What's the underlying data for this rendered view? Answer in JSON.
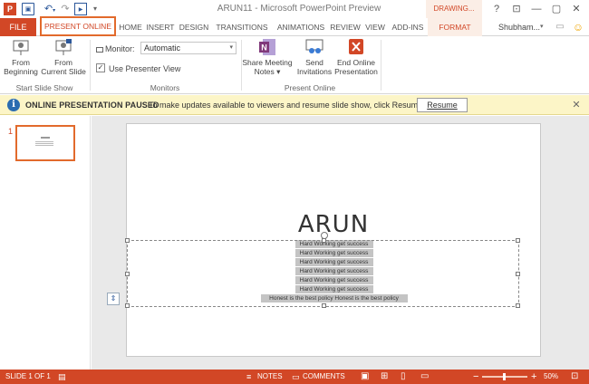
{
  "title_bar": {
    "app_logo": "P",
    "window_title": "ARUN11 - Microsoft PowerPoint Preview",
    "context_tab_group": "DRAWING...",
    "help_label": "?",
    "ribbon_display_label": "⊡",
    "minimize_label": "—",
    "restore_label": "▢",
    "close_label": "✕"
  },
  "tabs": {
    "file": "FILE",
    "items": [
      "PRESENT ONLINE",
      "HOME",
      "INSERT",
      "DESIGN",
      "TRANSITIONS",
      "ANIMATIONS",
      "REVIEW",
      "VIEW",
      "ADD-INS",
      "FORMAT"
    ],
    "active": "PRESENT ONLINE",
    "user_name": "Shubham..."
  },
  "ribbon": {
    "start_slide_show": {
      "from_beginning": [
        "From",
        "Beginning"
      ],
      "from_current": [
        "From",
        "Current Slide"
      ],
      "group_label": "Start Slide Show"
    },
    "monitors": {
      "monitor_label": "Monitor:",
      "monitor_value": "Automatic",
      "presenter_view_label": "Use Presenter View",
      "presenter_view_checked": true,
      "group_label": "Monitors"
    },
    "present_online": {
      "share_notes": [
        "Share Meeting",
        "Notes ▾"
      ],
      "send_invitations": [
        "Send",
        "Invitations"
      ],
      "end_online": [
        "End Online",
        "Presentation"
      ],
      "group_label": "Present Online"
    }
  },
  "message_bar": {
    "title": "ONLINE PRESENTATION PAUSED",
    "text": "To make updates available to viewers and resume slide show, click Resume.",
    "resume_label": "Resume",
    "close_label": "✕"
  },
  "thumbnails": [
    {
      "number": "1"
    }
  ],
  "slide": {
    "title": "ARUN",
    "body_lines": [
      "Hard Working get success",
      "Hard Working get success",
      "Hard Working get success",
      "Hard Working get success",
      "Hard Working get success",
      "Hard Working get success"
    ],
    "last_line": "Honest is the best policy Honest is the best policy"
  },
  "status_bar": {
    "slide_info": "SLIDE 1 OF 1",
    "notes_label": "NOTES",
    "comments_label": "COMMENTS",
    "zoom_minus": "−",
    "zoom_plus": "+",
    "zoom_level": "50%"
  },
  "colors": {
    "accent": "#d24726",
    "message_bar": "#fcf5c7",
    "highlight_outline": "#e26a2c"
  }
}
